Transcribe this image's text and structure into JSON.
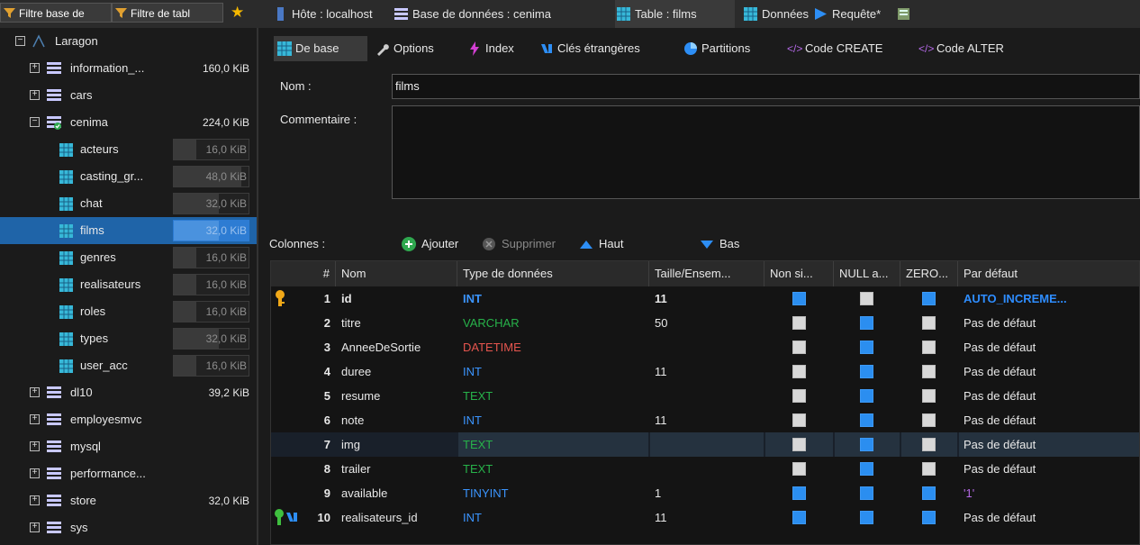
{
  "filter_tabs": [
    "Filtre base de",
    "Filtre de tabl"
  ],
  "crumbs": [
    "Hôte : localhost",
    "Base de données : cenima",
    "Table : films",
    "Données",
    "Requête*"
  ],
  "tree": {
    "root": "Laragon",
    "items": [
      {
        "label": "information_...",
        "size": "160,0 KiB",
        "kind": "db",
        "exp": "+"
      },
      {
        "label": "cars",
        "size": "",
        "kind": "db",
        "exp": "+"
      },
      {
        "label": "cenima",
        "size": "224,0 KiB",
        "kind": "db-open",
        "exp": "−"
      },
      {
        "label": "acteurs",
        "size": "16,0 KiB",
        "kind": "table",
        "fill": 0.3
      },
      {
        "label": "casting_gr...",
        "size": "48,0 KiB",
        "kind": "table",
        "fill": 0.9
      },
      {
        "label": "chat",
        "size": "32,0 KiB",
        "kind": "table",
        "fill": 0.6
      },
      {
        "label": "films",
        "size": "32,0 KiB",
        "kind": "table",
        "fill": 0.6,
        "selected": true
      },
      {
        "label": "genres",
        "size": "16,0 KiB",
        "kind": "table",
        "fill": 0.3
      },
      {
        "label": "realisateurs",
        "size": "16,0 KiB",
        "kind": "table",
        "fill": 0.3
      },
      {
        "label": "roles",
        "size": "16,0 KiB",
        "kind": "table",
        "fill": 0.3
      },
      {
        "label": "types",
        "size": "32,0 KiB",
        "kind": "table",
        "fill": 0.6
      },
      {
        "label": "user_acc",
        "size": "16,0 KiB",
        "kind": "table",
        "fill": 0.3
      },
      {
        "label": "dl10",
        "size": "39,2 KiB",
        "kind": "db",
        "exp": "+"
      },
      {
        "label": "employesmvc",
        "size": "",
        "kind": "db",
        "exp": "+"
      },
      {
        "label": "mysql",
        "size": "",
        "kind": "db",
        "exp": "+"
      },
      {
        "label": "performance...",
        "size": "",
        "kind": "db",
        "exp": "+"
      },
      {
        "label": "store",
        "size": "32,0 KiB",
        "kind": "db",
        "exp": "+"
      },
      {
        "label": "sys",
        "size": "",
        "kind": "db",
        "exp": "+"
      }
    ]
  },
  "subtabs": [
    "De base",
    "Options",
    "Index",
    "Clés étrangères",
    "Partitions",
    "Code CREATE",
    "Code ALTER"
  ],
  "form": {
    "name_label": "Nom :",
    "name_value": "films",
    "comment_label": "Commentaire :",
    "comment_value": ""
  },
  "columns_bar": {
    "label": "Colonnes :",
    "add": "Ajouter",
    "remove": "Supprimer",
    "up": "Haut",
    "down": "Bas"
  },
  "grid": {
    "headers": [
      "#",
      "Nom",
      "Type de données",
      "Taille/Ensem...",
      "Non si...",
      "NULL a...",
      "ZERO...",
      "Par défaut"
    ],
    "rows": [
      {
        "n": "1",
        "name": "id",
        "type": "INT",
        "size": "11",
        "unsigned": true,
        "null": false,
        "zero": true,
        "default": "AUTO_INCREME...",
        "key": "pk"
      },
      {
        "n": "2",
        "name": "titre",
        "type": "VARCHAR",
        "size": "50",
        "unsigned": false,
        "null": true,
        "zero": false,
        "default": "Pas de défaut"
      },
      {
        "n": "3",
        "name": "AnneeDeSortie",
        "type": "DATETIME",
        "size": "",
        "unsigned": false,
        "null": true,
        "zero": false,
        "default": "Pas de défaut"
      },
      {
        "n": "4",
        "name": "duree",
        "type": "INT",
        "size": "11",
        "unsigned": false,
        "null": true,
        "zero": false,
        "default": "Pas de défaut"
      },
      {
        "n": "5",
        "name": "resume",
        "type": "TEXT",
        "size": "",
        "unsigned": false,
        "null": true,
        "zero": false,
        "default": "Pas de défaut"
      },
      {
        "n": "6",
        "name": "note",
        "type": "INT",
        "size": "11",
        "unsigned": false,
        "null": true,
        "zero": false,
        "default": "Pas de défaut"
      },
      {
        "n": "7",
        "name": "img",
        "type": "TEXT",
        "size": "",
        "unsigned": false,
        "null": true,
        "zero": false,
        "default": "Pas de défaut",
        "hl": true
      },
      {
        "n": "8",
        "name": "trailer",
        "type": "TEXT",
        "size": "",
        "unsigned": false,
        "null": true,
        "zero": false,
        "default": "Pas de défaut"
      },
      {
        "n": "9",
        "name": "available",
        "type": "TINYINT",
        "size": "1",
        "unsigned": true,
        "null": true,
        "zero": true,
        "default": "'1'"
      },
      {
        "n": "10",
        "name": "realisateurs_id",
        "type": "INT",
        "size": "11",
        "unsigned": true,
        "null": true,
        "zero": true,
        "default": "Pas de défaut",
        "key": "fk"
      }
    ]
  }
}
